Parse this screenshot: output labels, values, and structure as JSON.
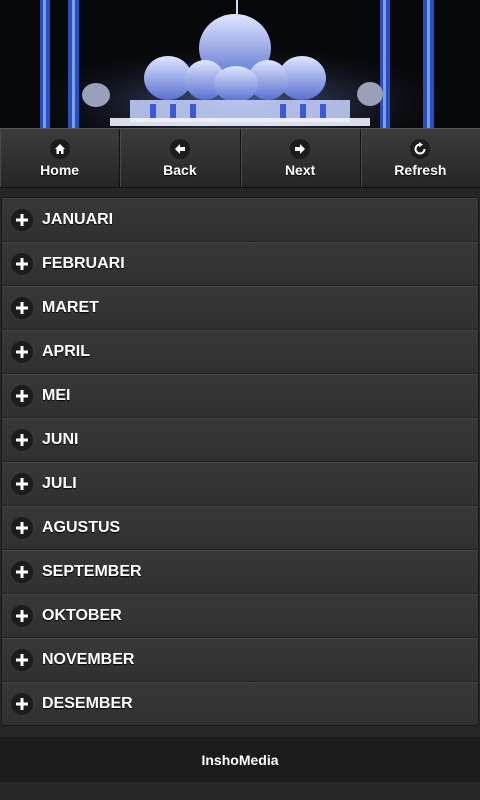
{
  "banner": {
    "image": "mosque-night-photo"
  },
  "nav": {
    "items": [
      {
        "label": "Home",
        "icon": "home-icon"
      },
      {
        "label": "Back",
        "icon": "arrow-left-icon"
      },
      {
        "label": "Next",
        "icon": "arrow-right-icon"
      },
      {
        "label": "Refresh",
        "icon": "refresh-icon"
      }
    ]
  },
  "months": [
    {
      "label": "JANUARI"
    },
    {
      "label": "FEBRUARI"
    },
    {
      "label": "MARET"
    },
    {
      "label": "APRIL"
    },
    {
      "label": "MEI"
    },
    {
      "label": "JUNI"
    },
    {
      "label": "JULI"
    },
    {
      "label": "AGUSTUS"
    },
    {
      "label": "SEPTEMBER"
    },
    {
      "label": "OKTOBER"
    },
    {
      "label": "NOVEMBER"
    },
    {
      "label": "DESEMBER"
    }
  ],
  "footer": {
    "label": "InshoMedia"
  },
  "colors": {
    "background": "#262626",
    "item": "#333333",
    "footer": "#1b1b1b"
  }
}
